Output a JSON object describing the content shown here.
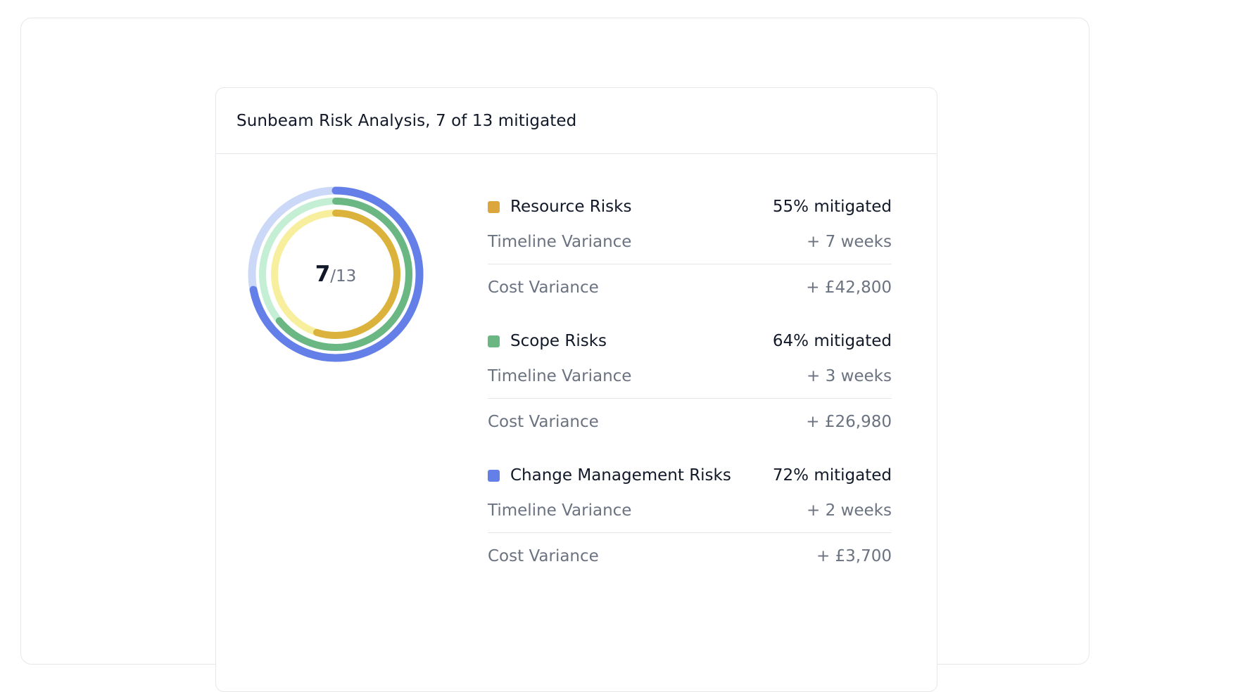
{
  "header": {
    "title": "Sunbeam Risk Analysis, 7 of 13 mitigated"
  },
  "chart_data": {
    "type": "radial-progress",
    "center": {
      "value": "7",
      "total": "/13"
    },
    "rings": [
      {
        "name": "Change Management Risks",
        "fraction": 0.72,
        "color": "#6480e8",
        "track_color": "#cbd8f8"
      },
      {
        "name": "Scope Risks",
        "fraction": 0.64,
        "color": "#6ab784",
        "track_color": "#c5efd5"
      },
      {
        "name": "Resource Risks",
        "fraction": 0.55,
        "color": "#dbb23c",
        "track_color": "#f8ef9e"
      }
    ]
  },
  "legend": {
    "groups": [
      {
        "name": "Resource Risks",
        "color": "#dba63c",
        "pct_label": "55% mitigated",
        "timeline_label": "Timeline Variance",
        "timeline_value": "+ 7 weeks",
        "cost_label": "Cost Variance",
        "cost_value": "+ £42,800"
      },
      {
        "name": "Scope Risks",
        "color": "#6ab784",
        "pct_label": "64% mitigated",
        "timeline_label": "Timeline Variance",
        "timeline_value": "+ 3 weeks",
        "cost_label": "Cost Variance",
        "cost_value": "+ £26,980"
      },
      {
        "name": "Change Management Risks",
        "color": "#6480e8",
        "pct_label": "72% mitigated",
        "timeline_label": "Timeline Variance",
        "timeline_value": "+ 2 weeks",
        "cost_label": "Cost Variance",
        "cost_value": "+ £3,700"
      }
    ]
  }
}
